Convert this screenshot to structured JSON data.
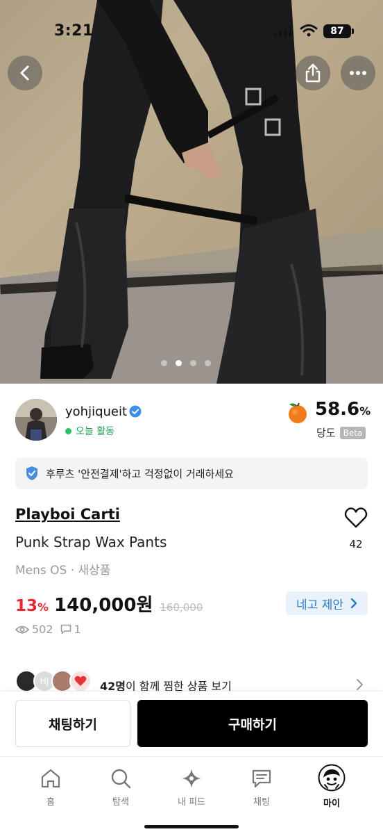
{
  "status_bar": {
    "time": "3:21",
    "battery": "87"
  },
  "gallery": {
    "page_count": 4,
    "active_index": 1
  },
  "seller": {
    "username": "yohjiqueit",
    "activity": "오늘 활동",
    "score_value": "58.6",
    "score_unit": "%",
    "score_label": "당도",
    "beta_label": "Beta"
  },
  "safety_banner": "후루츠 '안전결제'하고 걱정없이 거래하세요",
  "product": {
    "brand": "Playboi Carti",
    "title": "Punk Strap Wax Pants",
    "meta": "Mens OS · 새상품",
    "discount": "13",
    "discount_unit": "%",
    "price": "140,000원",
    "original_price": "160,000",
    "offer_label": "네고 제안",
    "likes": "42",
    "views": "502",
    "comments": "1"
  },
  "together": {
    "count": "42명",
    "text": "이 함께 찜한 상품 보기",
    "face_text": "HJ"
  },
  "actions": {
    "chat": "채팅하기",
    "buy": "구매하기"
  },
  "tabs": [
    {
      "label": "홈",
      "icon": "home-icon"
    },
    {
      "label": "탐색",
      "icon": "search-icon"
    },
    {
      "label": "내 피드",
      "icon": "sparkle-icon"
    },
    {
      "label": "채팅",
      "icon": "chat-icon"
    },
    {
      "label": "마이",
      "icon": "profile-avatar-icon"
    }
  ],
  "colors": {
    "accent_red": "#e3262f",
    "offer_blue": "#2b7bc9",
    "online_green": "#27c264",
    "buy_black": "#000000"
  }
}
